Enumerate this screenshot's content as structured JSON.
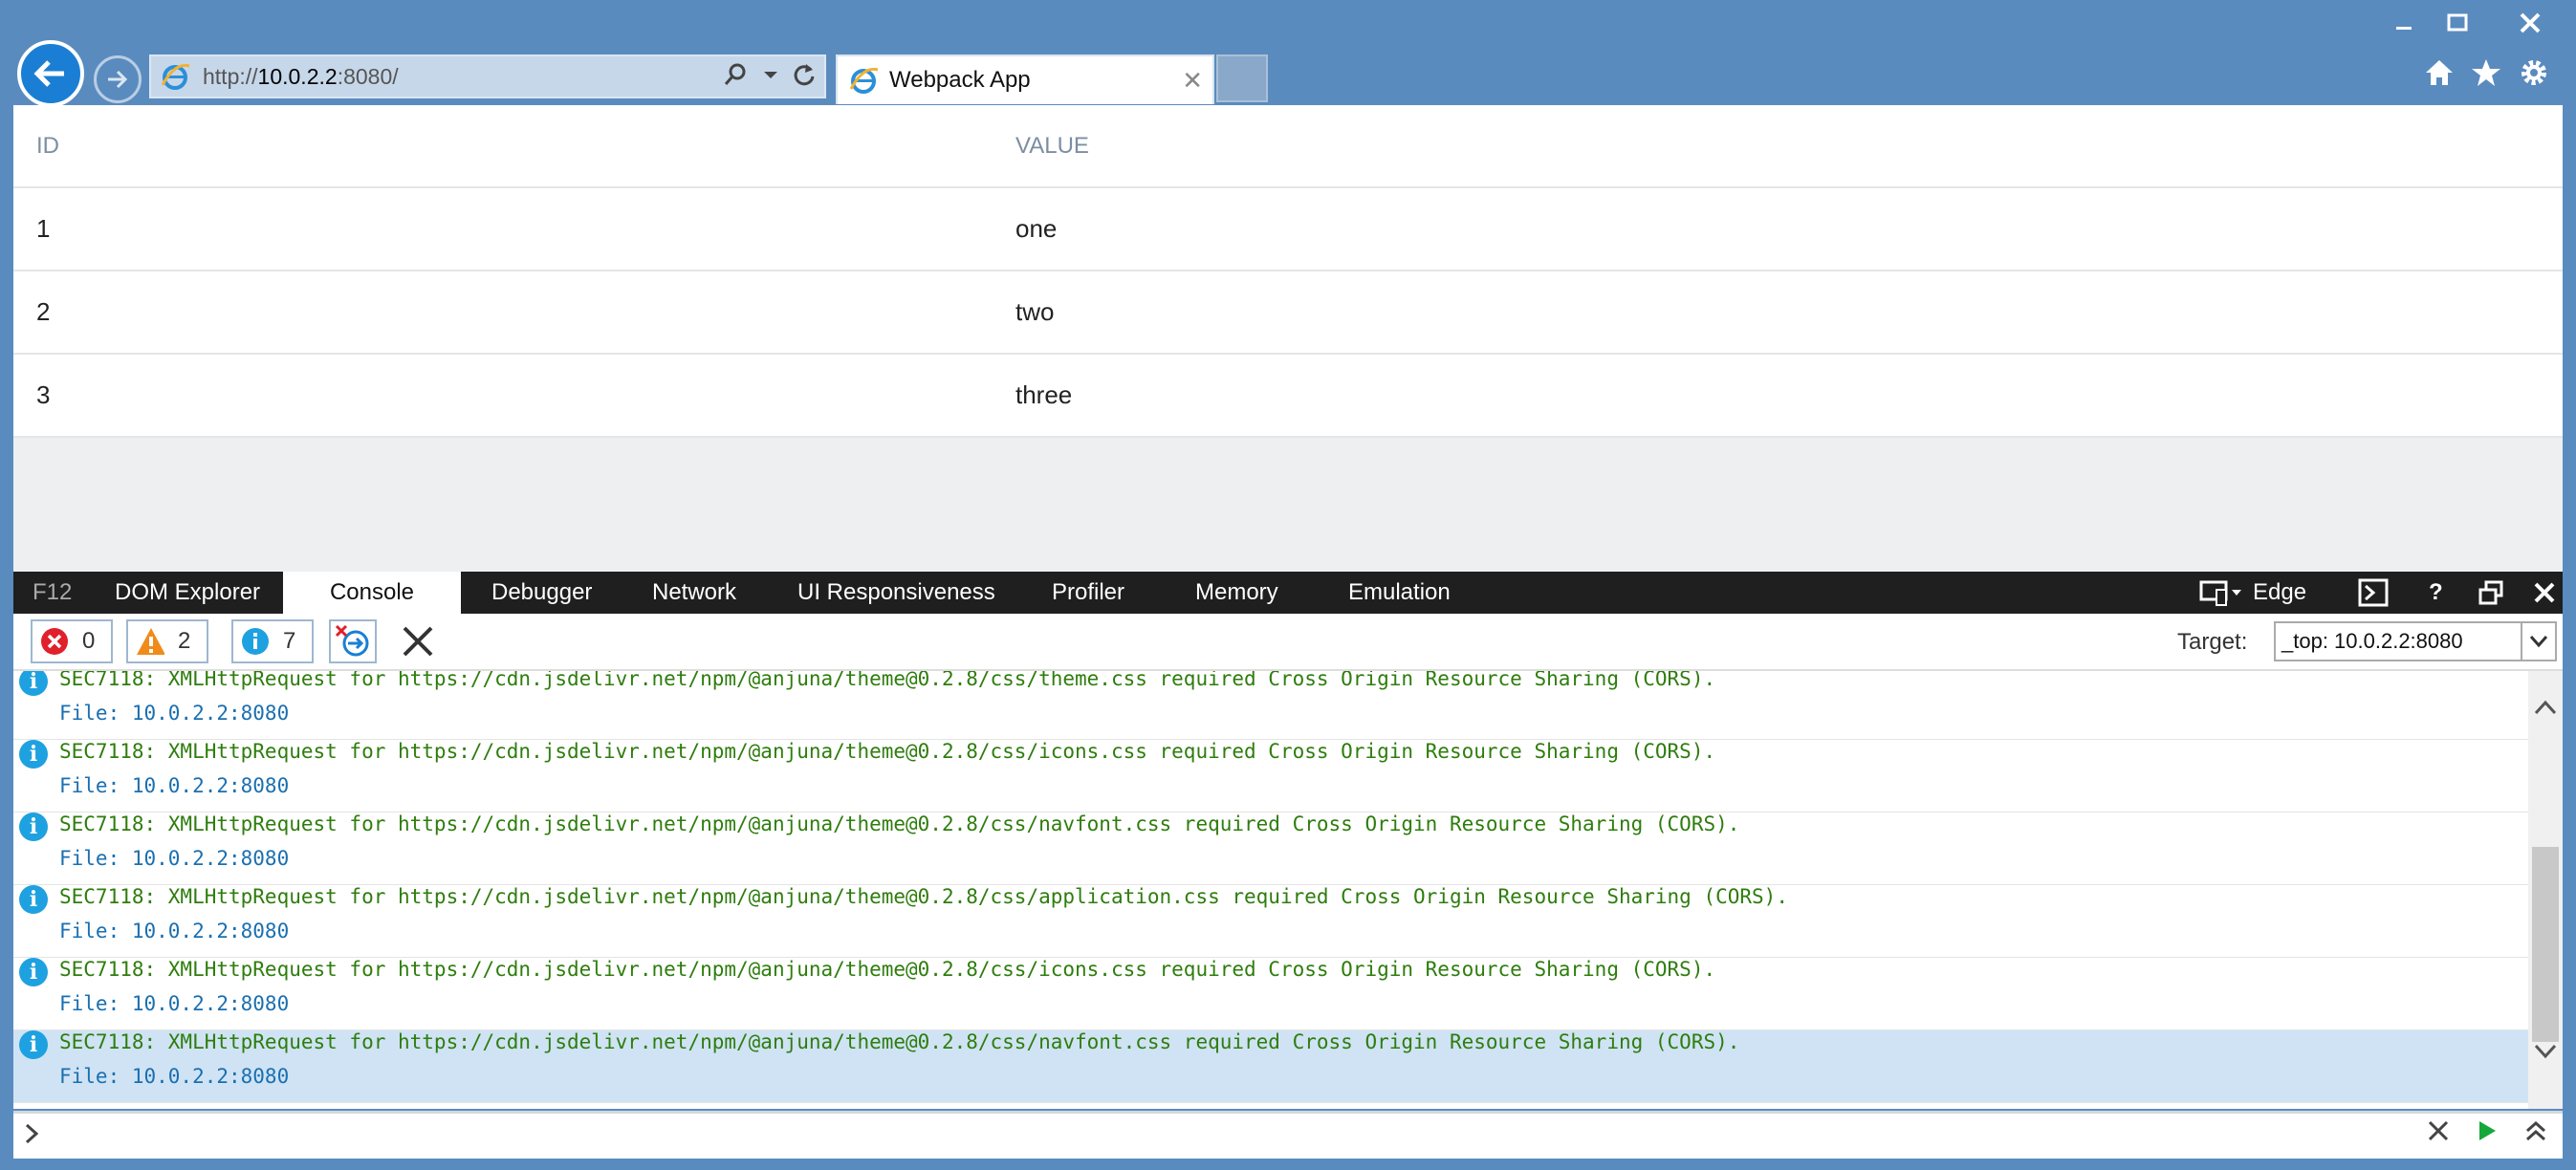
{
  "browser": {
    "address_url_prefix": "http://",
    "address_url_host": "10.0.2.2",
    "address_url_suffix": ":8080/",
    "tab_title": "Webpack App"
  },
  "table": {
    "headers": [
      "ID",
      "VALUE"
    ],
    "rows": [
      {
        "id": "1",
        "value": "one"
      },
      {
        "id": "2",
        "value": "two"
      },
      {
        "id": "3",
        "value": "three"
      }
    ]
  },
  "devtools": {
    "f12_label": "F12",
    "tabs": [
      "DOM Explorer",
      "Console",
      "Debugger",
      "Network",
      "UI Responsiveness",
      "Profiler",
      "Memory",
      "Emulation"
    ],
    "active_tab": "Console",
    "document_mode": "Edge",
    "counters": {
      "errors": "0",
      "warnings": "2",
      "messages": "7"
    },
    "target_label": "Target:",
    "target_value": "_top: 10.0.2.2:8080",
    "console_messages": [
      {
        "message": "SEC7118: XMLHttpRequest for https://cdn.jsdelivr.net/npm/@anjuna/theme@0.2.8/css/theme.css required Cross Origin Resource Sharing (CORS).",
        "file": "File: 10.0.2.2:8080"
      },
      {
        "message": "SEC7118: XMLHttpRequest for https://cdn.jsdelivr.net/npm/@anjuna/theme@0.2.8/css/icons.css required Cross Origin Resource Sharing (CORS).",
        "file": "File: 10.0.2.2:8080"
      },
      {
        "message": "SEC7118: XMLHttpRequest for https://cdn.jsdelivr.net/npm/@anjuna/theme@0.2.8/css/navfont.css required Cross Origin Resource Sharing (CORS).",
        "file": "File: 10.0.2.2:8080"
      },
      {
        "message": "SEC7118: XMLHttpRequest for https://cdn.jsdelivr.net/npm/@anjuna/theme@0.2.8/css/application.css required Cross Origin Resource Sharing (CORS).",
        "file": "File: 10.0.2.2:8080"
      },
      {
        "message": "SEC7118: XMLHttpRequest for https://cdn.jsdelivr.net/npm/@anjuna/theme@0.2.8/css/icons.css required Cross Origin Resource Sharing (CORS).",
        "file": "File: 10.0.2.2:8080"
      },
      {
        "message": "SEC7118: XMLHttpRequest for https://cdn.jsdelivr.net/npm/@anjuna/theme@0.2.8/css/navfont.css required Cross Origin Resource Sharing (CORS).",
        "file": "File: 10.0.2.2:8080"
      }
    ],
    "selected_message_index": 5
  },
  "colors": {
    "window_frame": "#5a8bbf",
    "accent_blue": "#1a7fd4",
    "console_message_green": "#2e7d0d",
    "console_file_blue": "#1a6fb0",
    "selected_row": "#cfe3f4"
  }
}
